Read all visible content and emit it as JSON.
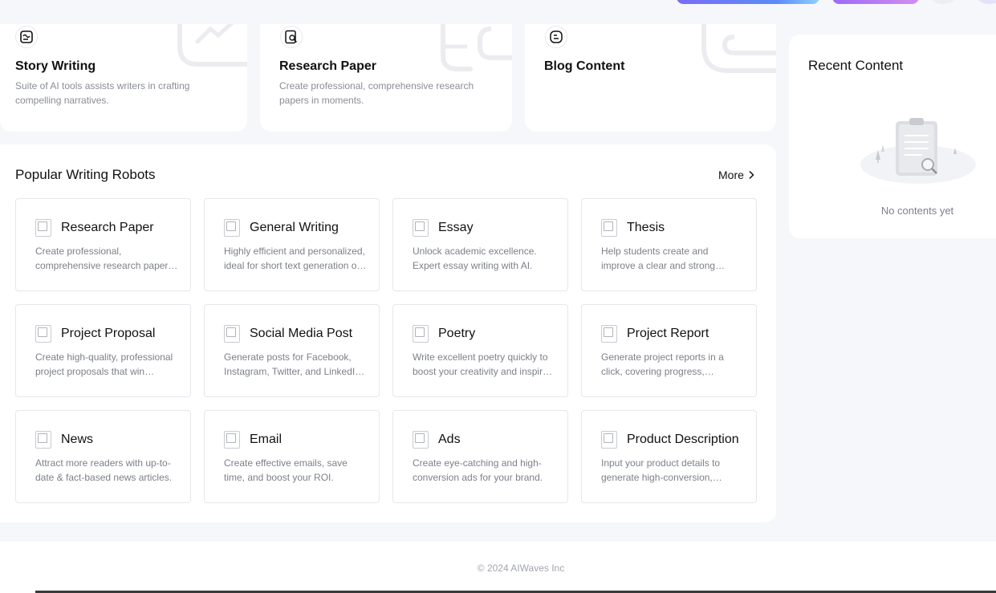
{
  "top_cards": [
    {
      "title": "Story Writing",
      "desc": "Suite of AI tools assists writers in crafting compelling narratives.",
      "icon": "story-icon"
    },
    {
      "title": "Research Paper",
      "desc": "Create professional, comprehensive research papers in moments.",
      "icon": "research-icon"
    },
    {
      "title": "Blog Content",
      "desc": "",
      "icon": "blog-icon"
    }
  ],
  "popular": {
    "title": "Popular Writing Robots",
    "more_label": "More",
    "items": [
      {
        "title": "Research Paper",
        "desc": "Create professional, comprehensive research papers in moments."
      },
      {
        "title": "General Writing",
        "desc": "Highly efficient and personalized, ideal for short text generation on any topic."
      },
      {
        "title": "Essay",
        "desc": "Unlock academic excellence. Expert essay writing with AI."
      },
      {
        "title": "Thesis",
        "desc": "Help students create and improve a clear and strong thesis."
      },
      {
        "title": "Project Proposal",
        "desc": "Create high-quality, professional project proposals that win approval."
      },
      {
        "title": "Social Media Post",
        "desc": "Generate posts for Facebook, Instagram, Twitter, and LinkedIn in seconds."
      },
      {
        "title": "Poetry",
        "desc": "Write excellent poetry quickly to boost your creativity and inspire readers."
      },
      {
        "title": "Project Report",
        "desc": "Generate project reports in a click, covering progress, milestones, and results."
      },
      {
        "title": "News",
        "desc": "Attract more readers with up-to-date & fact-based news articles."
      },
      {
        "title": "Email",
        "desc": "Create effective emails, save time, and boost your ROI."
      },
      {
        "title": "Ads",
        "desc": "Create eye-catching and high-conversion ads for your brand."
      },
      {
        "title": "Product Description",
        "desc": "Input your product details to generate high-conversion, compelling descriptions."
      }
    ]
  },
  "recent": {
    "title": "Recent Content",
    "empty_text": "No contents yet"
  },
  "footer": {
    "copyright": "© 2024 AIWaves Inc"
  },
  "colors": {
    "page_bg": "#f6f7fb",
    "card_bg": "#ffffff",
    "muted_text": "#8a8d96",
    "accent_gradient_start": "#7b6cf6"
  }
}
